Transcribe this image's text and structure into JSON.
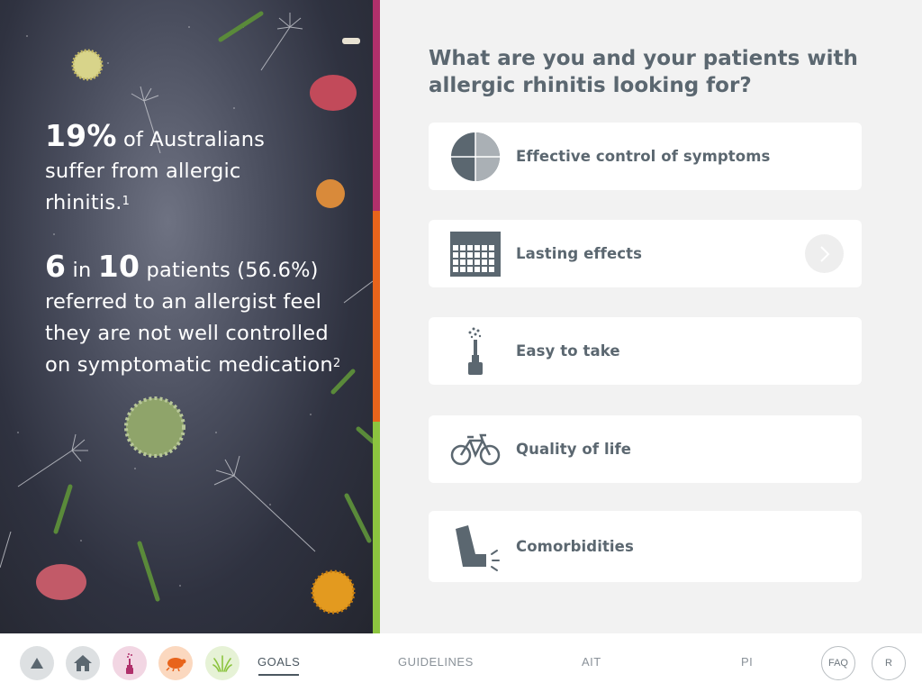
{
  "hero": {
    "stat1": {
      "big": "19%",
      "rest": " of Australians suffer from allergic rhinitis.",
      "ref": "1"
    },
    "stat2": {
      "big1": "6",
      "mid": " in ",
      "big2": "10",
      "rest": " patients (56.6%) referred to an allergist feel they are not well controlled on symptomatic medication",
      "ref": "2"
    }
  },
  "colors": {
    "strip_top": "#b0306b",
    "strip_mid": "#e8641b",
    "strip_bottom": "#8cc43f",
    "text_slate": "#5b6770"
  },
  "question": "What are you and your patients with allergic rhinitis looking for?",
  "cards": [
    {
      "label": "Effective control of symptoms",
      "icon": "pie-chart-icon"
    },
    {
      "label": "Lasting effects",
      "icon": "calendar-icon"
    },
    {
      "label": "Easy to take",
      "icon": "spray-bottle-icon"
    },
    {
      "label": "Quality of life",
      "icon": "bicycle-icon"
    },
    {
      "label": "Comorbidities",
      "icon": "inhaler-icon"
    }
  ],
  "nav": {
    "icons": [
      "up-arrow-icon",
      "home-icon",
      "spray-icon",
      "mite-icon",
      "grass-icon"
    ],
    "links": [
      "GOALS",
      "GUIDELINES",
      "AIT",
      "PI"
    ],
    "faq": "FAQ",
    "r": "R"
  }
}
